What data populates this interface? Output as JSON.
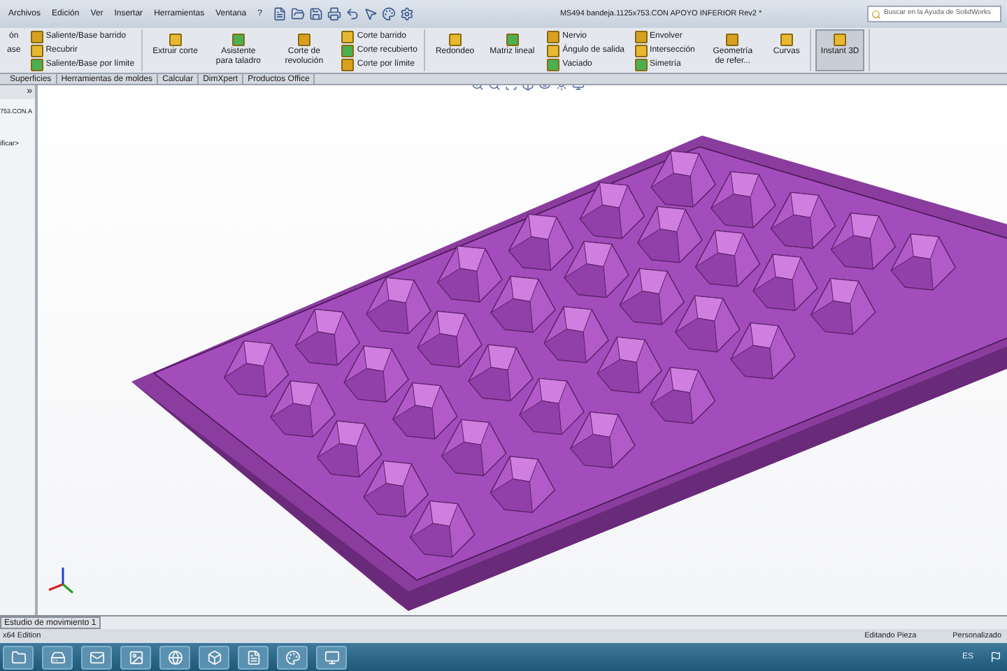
{
  "menu": [
    "Archivos",
    "Edición",
    "Ver",
    "Insertar",
    "Herramientas",
    "Ventana",
    "?"
  ],
  "window": {
    "title": "MS494 bandeja.1125x753.CON APOYO INFERIOR Rev2 *"
  },
  "search": {
    "placeholder": "Buscar en la Ayuda de SolidWorks"
  },
  "ribbon": {
    "groups": [
      {
        "items": [
          {
            "kind": "cut",
            "label": "ón",
            "selected": false
          },
          {
            "kind": "cut",
            "label": "ase",
            "selected": false
          },
          {
            "kind": "small",
            "label": "Saliente/Base barrido",
            "selected": false
          },
          {
            "kind": "small",
            "label": "Recubrir",
            "selected": false
          },
          {
            "kind": "small",
            "label": "Saliente/Base por límite",
            "selected": false
          }
        ]
      },
      {
        "items": [
          {
            "kind": "large",
            "label": "Extruir corte",
            "selected": false
          },
          {
            "kind": "large",
            "label": "Asistente para taladro",
            "selected": false
          },
          {
            "kind": "large",
            "label": "Corte de revolución",
            "selected": false
          },
          {
            "kind": "small",
            "label": "Corte barrido",
            "selected": false
          },
          {
            "kind": "small",
            "label": "Corte recubierto",
            "selected": false
          },
          {
            "kind": "small",
            "label": "Corte por límite",
            "selected": false
          }
        ]
      },
      {
        "items": [
          {
            "kind": "large",
            "label": "Redondeo",
            "selected": false
          },
          {
            "kind": "large",
            "label": "Matriz lineal",
            "selected": false
          },
          {
            "kind": "small",
            "label": "Nervio",
            "selected": false
          },
          {
            "kind": "small",
            "label": "Ángulo de salida",
            "selected": false
          },
          {
            "kind": "small",
            "label": "Vaciado",
            "selected": false
          },
          {
            "kind": "small",
            "label": "Envolver",
            "selected": false
          },
          {
            "kind": "small",
            "label": "Intersección",
            "selected": false
          },
          {
            "kind": "small",
            "label": "Simetría",
            "selected": false
          },
          {
            "kind": "large",
            "label": "Geometría de refer...",
            "selected": false
          },
          {
            "kind": "large",
            "label": "Curvas",
            "selected": false
          }
        ]
      },
      {
        "items": [
          {
            "kind": "large",
            "label": "Instant 3D",
            "selected": true
          }
        ]
      }
    ]
  },
  "tabs": [
    {
      "label": "Superficies",
      "selected": false
    },
    {
      "label": "Herramientas de moldes",
      "selected": false
    },
    {
      "label": "Calcular",
      "selected": false
    },
    {
      "label": "DimXpert",
      "selected": false
    },
    {
      "label": "Productos Office",
      "selected": false
    }
  ],
  "sidebar": {
    "toggle": "»",
    "lines": [
      "753.CON.A",
      "ificar>"
    ]
  },
  "bottom_tab": {
    "label": "Estudio de movimiento 1"
  },
  "status_bar": {
    "left": "x64 Edition",
    "mode": "Editando Pieza",
    "units": "Personalizado"
  },
  "taskbar": {
    "language": "ES"
  }
}
